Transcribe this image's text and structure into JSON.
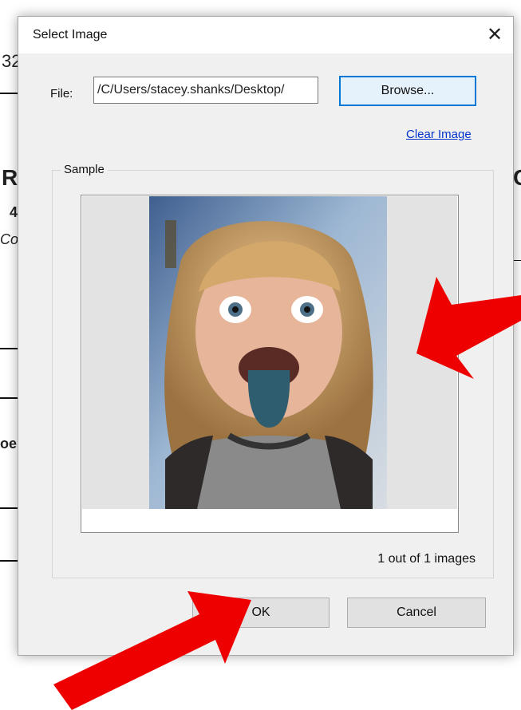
{
  "dialog": {
    "title": "Select Image",
    "close_glyph": "✕",
    "file_label": "File:",
    "file_value": "/C/Users/stacey.shanks/Desktop/",
    "browse_label": "Browse...",
    "clear_label": "Clear Image",
    "sample_label": "Sample",
    "count_text": "1 out of 1 images",
    "ok_label": "OK",
    "cancel_label": "Cancel"
  },
  "background": {
    "left_fragments": [
      "32",
      "R",
      "4",
      "Co",
      "oe"
    ],
    "right_fragments": [
      "C"
    ]
  },
  "colors": {
    "annotation_arrow": "#ee0000",
    "focus_border": "#0078d7",
    "link": "#0033cc"
  },
  "icons": {
    "close": "close-icon",
    "arrows": [
      "arrow-annotation-icon",
      "arrow-annotation-icon"
    ]
  }
}
